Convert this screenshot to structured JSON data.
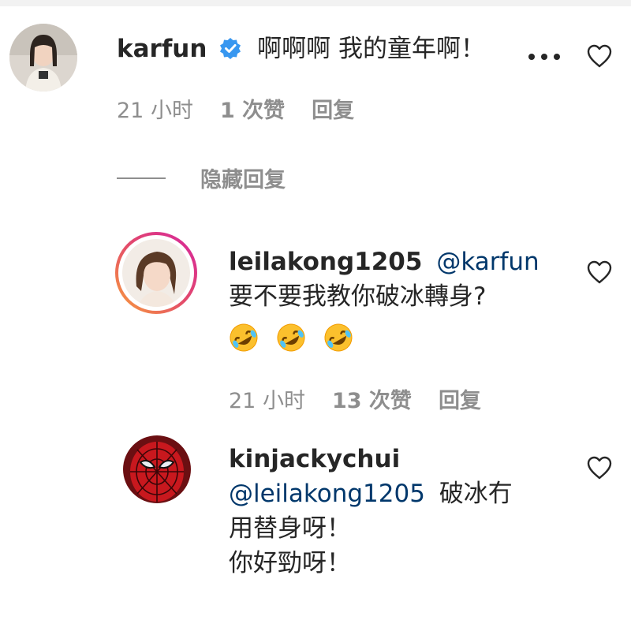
{
  "comments": [
    {
      "username": "karfun",
      "verified": true,
      "text": "啊啊啊 我的童年啊！",
      "time": "21 小时",
      "likes": "1 次赞",
      "reply_label": "回复"
    }
  ],
  "hide_replies_label": "隐藏回复",
  "replies": [
    {
      "username": "leilakong1205",
      "mention": "@karfun",
      "text": "要不要我教你破冰轉身?",
      "emoji_name": "rolling-on-floor-laughing-emoji",
      "emoji_count": 3,
      "time": "21 小时",
      "likes": "13 次赞",
      "reply_label": "回复",
      "has_story_ring": true
    },
    {
      "username": "kinjackychui",
      "mention": "@leilakong1205",
      "text_line1": "破冰冇",
      "text_line2": "用替身呀！",
      "text_line3": "你好勁呀！"
    }
  ],
  "icons": {
    "heart": "heart-outline-icon",
    "more": "more-options-icon",
    "verified": "verified-badge-icon"
  },
  "colors": {
    "mention": "#00376b",
    "meta": "#8e8e8e",
    "verified": "#3897f0",
    "story_ring_start": "#f9a13a",
    "story_ring_end": "#d6249f"
  }
}
